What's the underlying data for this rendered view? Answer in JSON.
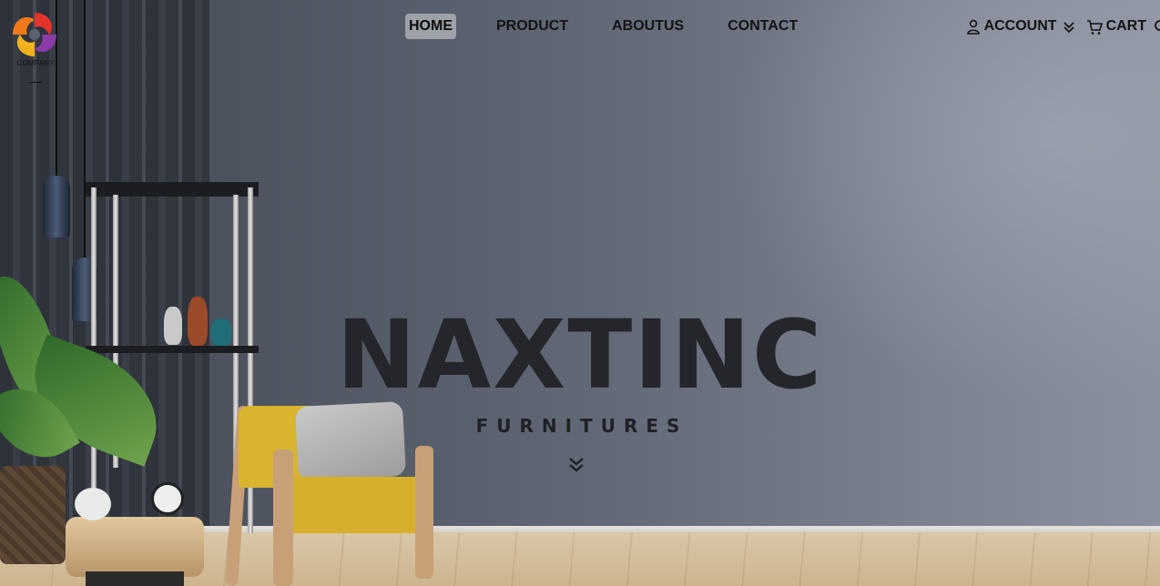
{
  "header": {
    "logo": {
      "text": "COMPANY",
      "icon": "swirl-logo-icon"
    },
    "nav": [
      {
        "label": "HOME",
        "active": true
      },
      {
        "label": "PRODUCT",
        "active": false
      },
      {
        "label": "ABOUTUS",
        "active": false
      },
      {
        "label": "CONTACT",
        "active": false
      }
    ],
    "account": {
      "label": "ACCOUNT",
      "icon": "user-icon",
      "caret_icon": "double-chevron-down-icon"
    },
    "cart": {
      "label": "CART",
      "icon": "cart-icon"
    },
    "search": {
      "icon": "search-icon"
    }
  },
  "hero": {
    "title": "NAXTINC",
    "subtitle": "FURNITURES",
    "scroll_icon": "double-chevron-down-icon"
  },
  "colors": {
    "nav_active_bg": "#9da1a8",
    "title_color": "#24262b",
    "wall": "#646b79",
    "chair": "#d6b02a"
  }
}
